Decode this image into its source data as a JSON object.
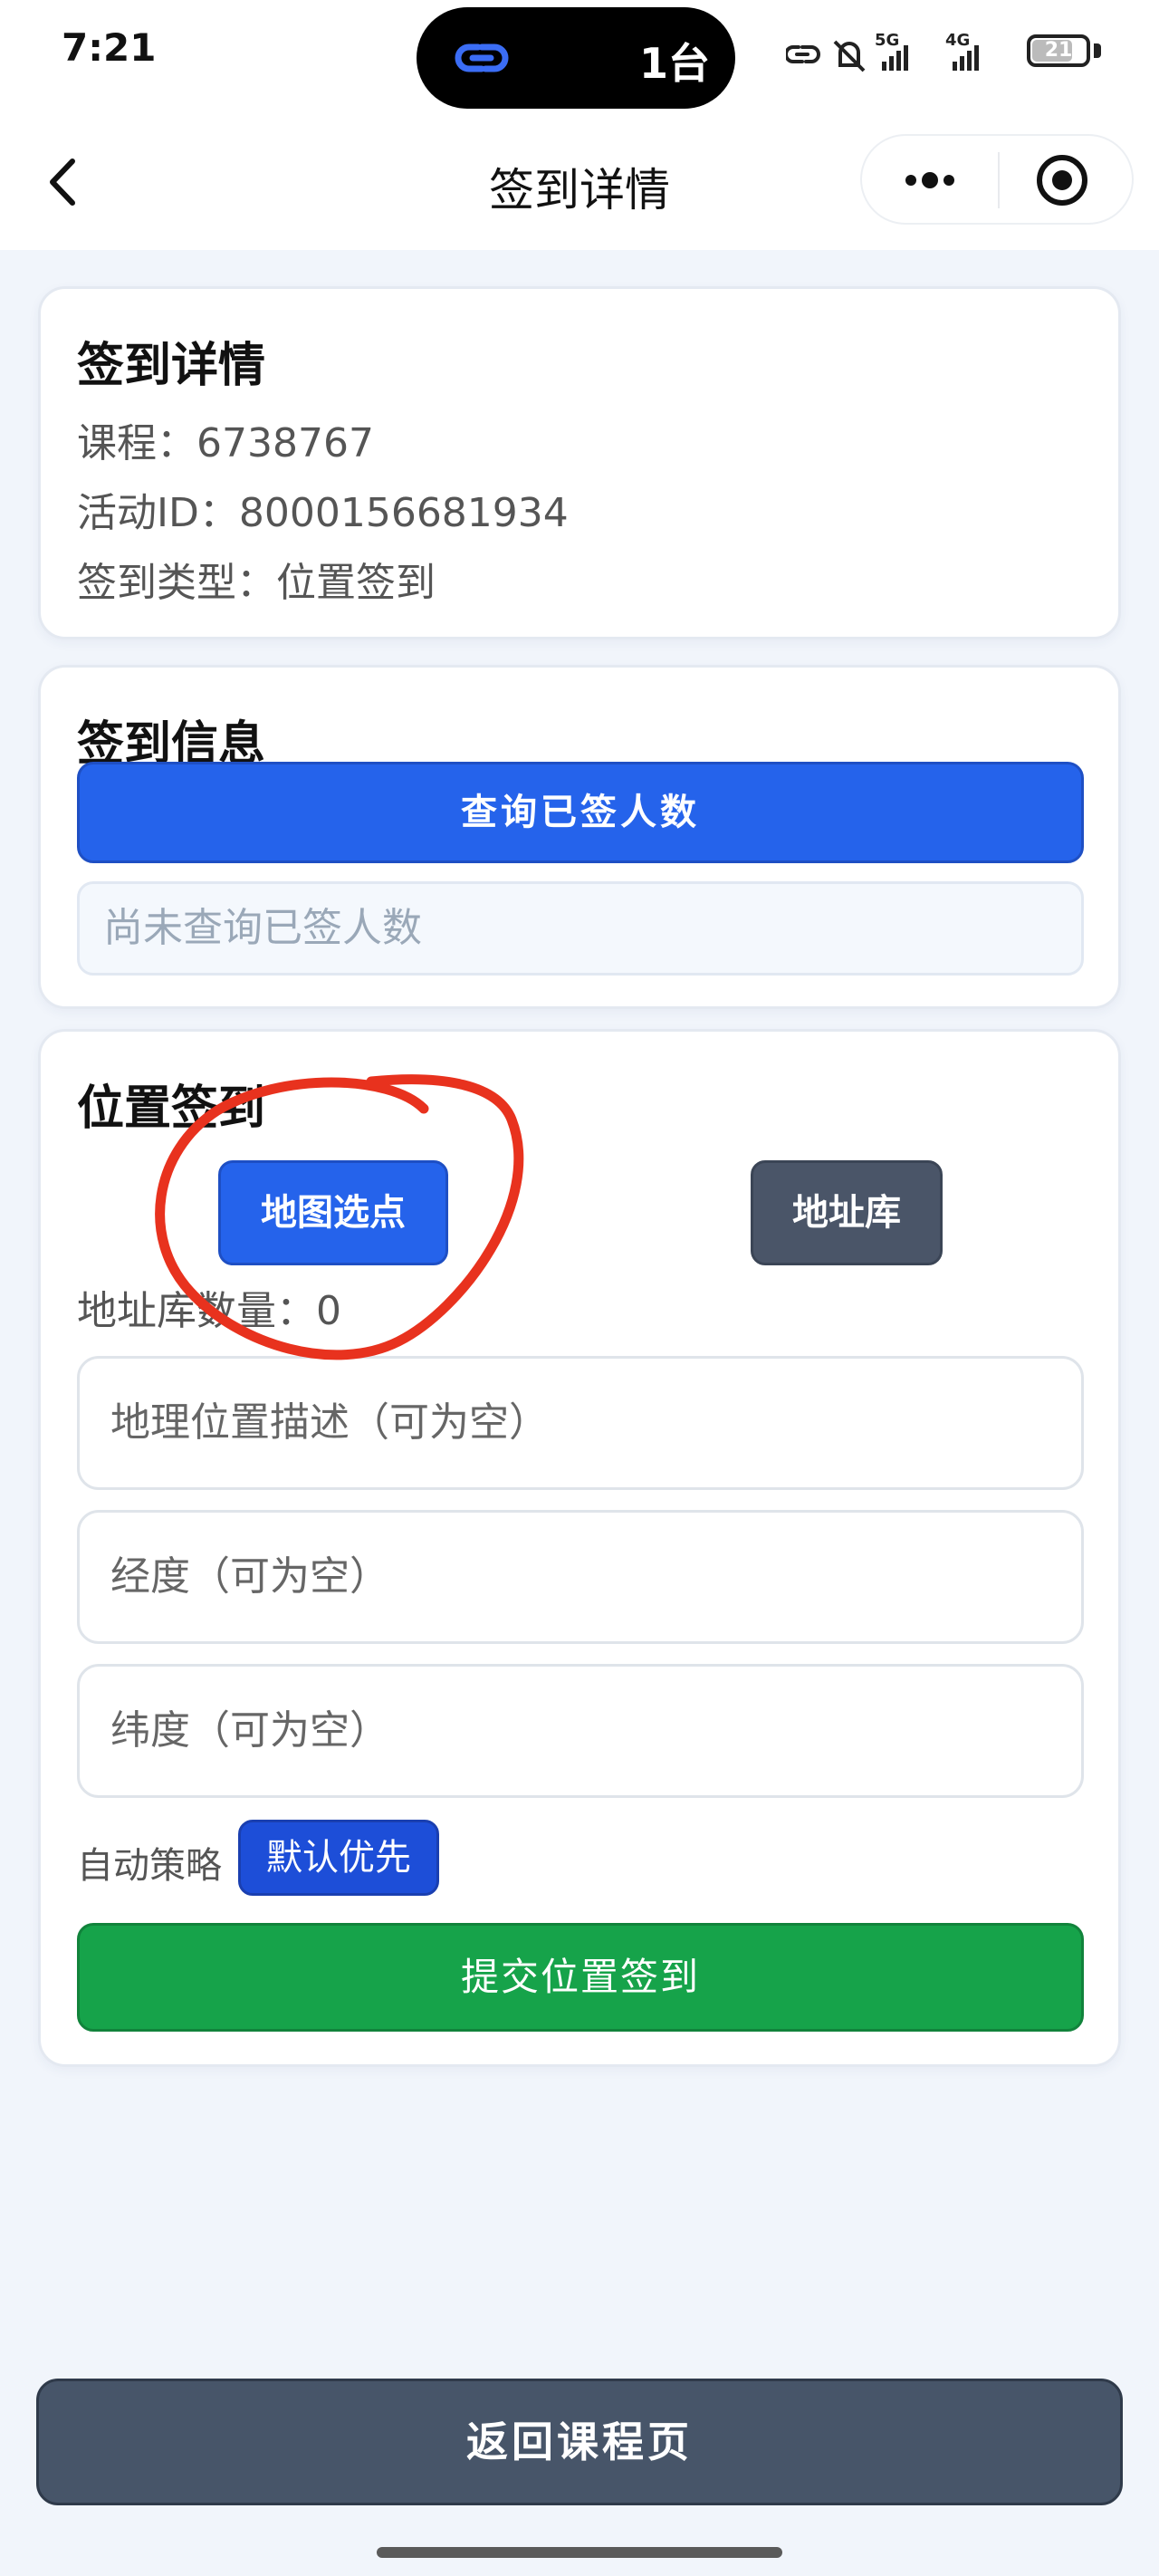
{
  "status_bar": {
    "time": "7:21",
    "island_text": "1台",
    "battery": "21"
  },
  "nav": {
    "title": "签到详情"
  },
  "details": {
    "title": "签到详情",
    "course": "课程：6738767",
    "activity_id": "活动ID：8000156681934",
    "type": "签到类型：位置签到"
  },
  "sign_info": {
    "title": "签到信息",
    "query_button": "查询已签人数",
    "status_placeholder": "尚未查询已签人数"
  },
  "location": {
    "title": "位置签到",
    "map_button": "地图选点",
    "library_button": "地址库",
    "library_count": "地址库数量：0",
    "desc_placeholder": "地理位置描述（可为空）",
    "lng_placeholder": "经度（可为空）",
    "lat_placeholder": "纬度（可为空）",
    "strategy_label": "自动策略",
    "strategy_value": "默认优先",
    "submit_button": "提交位置签到"
  },
  "footer": {
    "return_button": "返回课程页"
  },
  "colors": {
    "primary": "#2563eb",
    "success": "#16a34a",
    "slate": "#475569",
    "annotation": "#e8321e"
  }
}
